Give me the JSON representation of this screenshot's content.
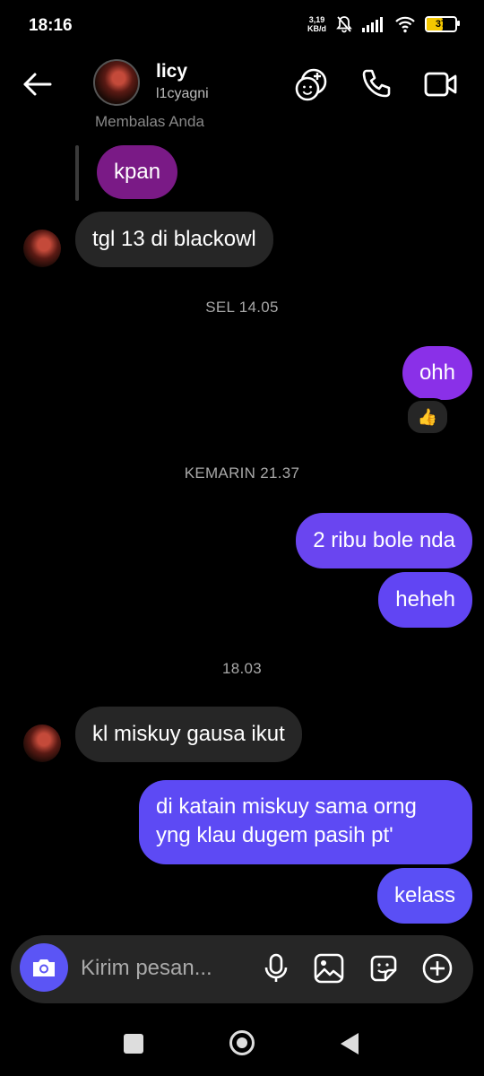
{
  "status": {
    "time": "18:16",
    "speed_top": "3,19",
    "speed_bottom": "KB/d",
    "battery": "37"
  },
  "header": {
    "name": "licy",
    "username": "l1cyagni"
  },
  "messages": {
    "reply_label": "Membalas Anda",
    "m1": "kpan",
    "m2": "tgl 13 di blackowl",
    "ts1": "SEL 14.05",
    "m3": "ohh",
    "reaction": "👍",
    "ts2": "KEMARIN 21.37",
    "m4": "2 ribu bole nda",
    "m5": "heheh",
    "ts3": "18.03",
    "m6": "kl miskuy gausa ikut",
    "m7_line1": "di katain miskuy sama orng",
    "m7_line2": "yng klau dugem pasih pt'",
    "m8": "kelass"
  },
  "composer": {
    "placeholder": "Kirim pesan..."
  },
  "colors": {
    "bubble_in": "#262626",
    "purple_dark": "#7a1a86",
    "purple_mid": "#8a30e8",
    "purple_blue": "#6a45f0",
    "indigo": "#5b55f5"
  }
}
